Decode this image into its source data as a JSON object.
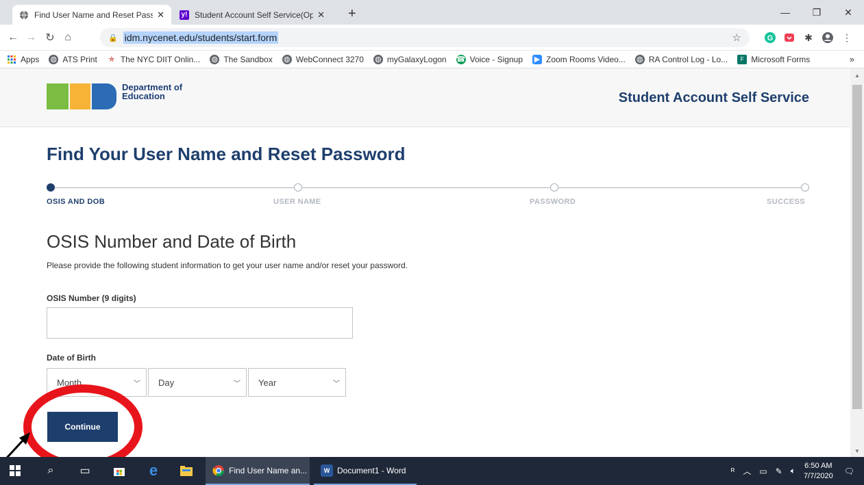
{
  "browser": {
    "tabs": [
      {
        "title": "Find User Name and Reset Passw",
        "icon": "globe-icon",
        "active": true
      },
      {
        "title": "Student Account Self Service(Op",
        "icon": "yahoo-icon",
        "active": false
      }
    ],
    "url": "idm.nycenet.edu/students/start.form",
    "bookmarks": [
      {
        "label": "Apps",
        "icon": "apps-grid-icon"
      },
      {
        "label": "ATS Print",
        "icon": "globe-icon"
      },
      {
        "label": "The NYC DIIT Onlin...",
        "icon": "star-seal-icon"
      },
      {
        "label": "The Sandbox",
        "icon": "globe-icon"
      },
      {
        "label": "WebConnect 3270",
        "icon": "globe-icon"
      },
      {
        "label": "myGalaxyLogon",
        "icon": "globe-icon"
      },
      {
        "label": "Voice - Signup",
        "icon": "voice-icon"
      },
      {
        "label": "Zoom Rooms Video...",
        "icon": "zoom-icon"
      },
      {
        "label": "RA Control Log - Lo...",
        "icon": "globe-icon"
      },
      {
        "label": "Microsoft Forms",
        "icon": "forms-icon"
      }
    ]
  },
  "header": {
    "logo_text_line1": "Department of",
    "logo_text_line2": "Education",
    "title": "Student Account Self Service"
  },
  "page": {
    "title": "Find Your User Name and Reset Password",
    "steps": [
      {
        "label": "OSIS AND DOB",
        "active": true
      },
      {
        "label": "USER NAME",
        "active": false
      },
      {
        "label": "PASSWORD",
        "active": false
      },
      {
        "label": "SUCCESS",
        "active": false
      }
    ],
    "section_title": "OSIS Number and Date of Birth",
    "instructions": "Please provide the following student information to get your user name and/or reset your password.",
    "osis_label": "OSIS Number (9 digits)",
    "osis_value": "",
    "dob_label": "Date of Birth",
    "month_value": "Month",
    "day_value": "Day",
    "year_value": "Year",
    "continue_label": "Continue"
  },
  "taskbar": {
    "apps": [
      {
        "label": "Find User Name an...",
        "icon": "chrome-icon"
      },
      {
        "label": "Document1 - Word",
        "icon": "word-icon"
      }
    ],
    "time": "6:50 AM",
    "date": "7/7/2020"
  },
  "colors": {
    "brand_navy": "#1e3f6d",
    "annotation_red": "#e8141b"
  }
}
